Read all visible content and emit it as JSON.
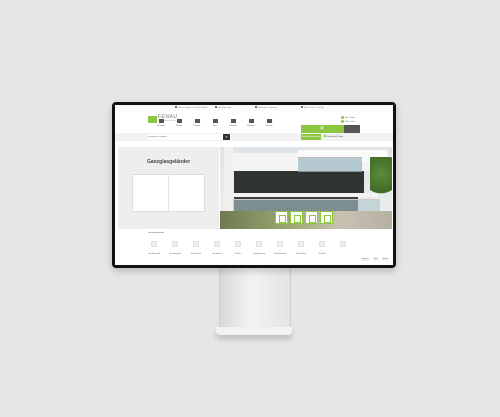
{
  "topbar": {
    "items": [
      "Service-Hotline +49 5921 304950",
      "Info@fenau.de",
      "Kostenlose Lieferung",
      "Mo-Fr 8:00 - 17:00 Uhr"
    ]
  },
  "header": {
    "logo_text": "FENAU",
    "logo_sub": "Sicher durchs Leben",
    "nav": [
      "Geländer",
      "Balkon",
      "Treppen",
      "Glas",
      "Zubehör",
      "Montage",
      "Kontakt"
    ],
    "account_label": "Mein Konto",
    "cart_label": "Warenkorb"
  },
  "search": {
    "placeholder": "Suchbegriff eingeben",
    "button_icon": "search-icon",
    "green_button_label": "Geländerkonfigurator",
    "shop_link_label": "Produktwelt Shop"
  },
  "page": {
    "title": "Ganzglasgeländer"
  },
  "hero": {
    "thumb_count": 4
  },
  "breadcrumb": "Ganzglasgeländer",
  "categories": {
    "labels": [
      "Glas-Bodenprofil",
      "Glas-Bodenprofil",
      "Glas-Handlauf",
      "Glas-Klemme",
      "Zubehör",
      "Glas-Abdeckung",
      "Glas-Bodenprofil",
      "Glas-Handlauf",
      "Glas-Glas"
    ]
  },
  "footer": {
    "buttons": [
      "Sortieren",
      "Filter",
      "Ansicht"
    ]
  },
  "colors": {
    "accent": "#8dc63f",
    "dark": "#333333"
  }
}
